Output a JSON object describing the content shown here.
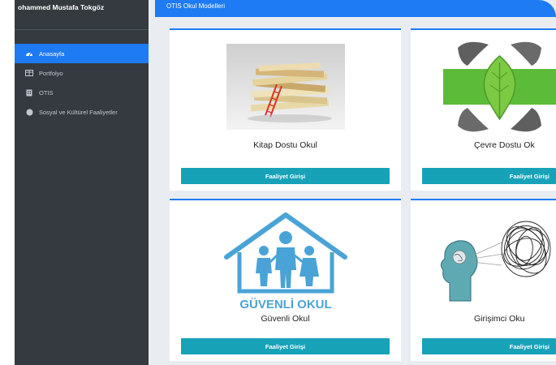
{
  "user": {
    "name": "ohammed Mustafa Tokgöz"
  },
  "sidebar": {
    "items": [
      {
        "label": "Anasayfa",
        "icon": "dashboard-icon",
        "active": true
      },
      {
        "label": "Portfolyo",
        "icon": "table-icon",
        "active": false
      },
      {
        "label": "OTIS",
        "icon": "building-icon",
        "active": false
      },
      {
        "label": "Sosyal ve Kültürel Faaliyetler",
        "icon": "circle-icon",
        "active": false
      }
    ]
  },
  "header": {
    "title": "OTIS Okul Modelleri"
  },
  "cards": [
    {
      "title": "Kitap Dostu Okul",
      "button": "Faaliyet Girişi",
      "image": "books-stack-image"
    },
    {
      "title": "Çevre Dostu Ok",
      "button": "Faaliyet Girişi",
      "image": "leaf-hands-image"
    },
    {
      "title": "Güvenli Okul",
      "button": "Faaliyet Girişi",
      "image": "safe-school-logo",
      "logo_text": "GÜVENLİ OKUL"
    },
    {
      "title": "Girişimci Oku",
      "button": "Faaliyet Girişi",
      "image": "head-scribble-image"
    }
  ],
  "colors": {
    "primary": "#1e7bf3",
    "sidebar": "#343a40",
    "button": "#17a2b8",
    "logo": "#4aa3d6"
  }
}
